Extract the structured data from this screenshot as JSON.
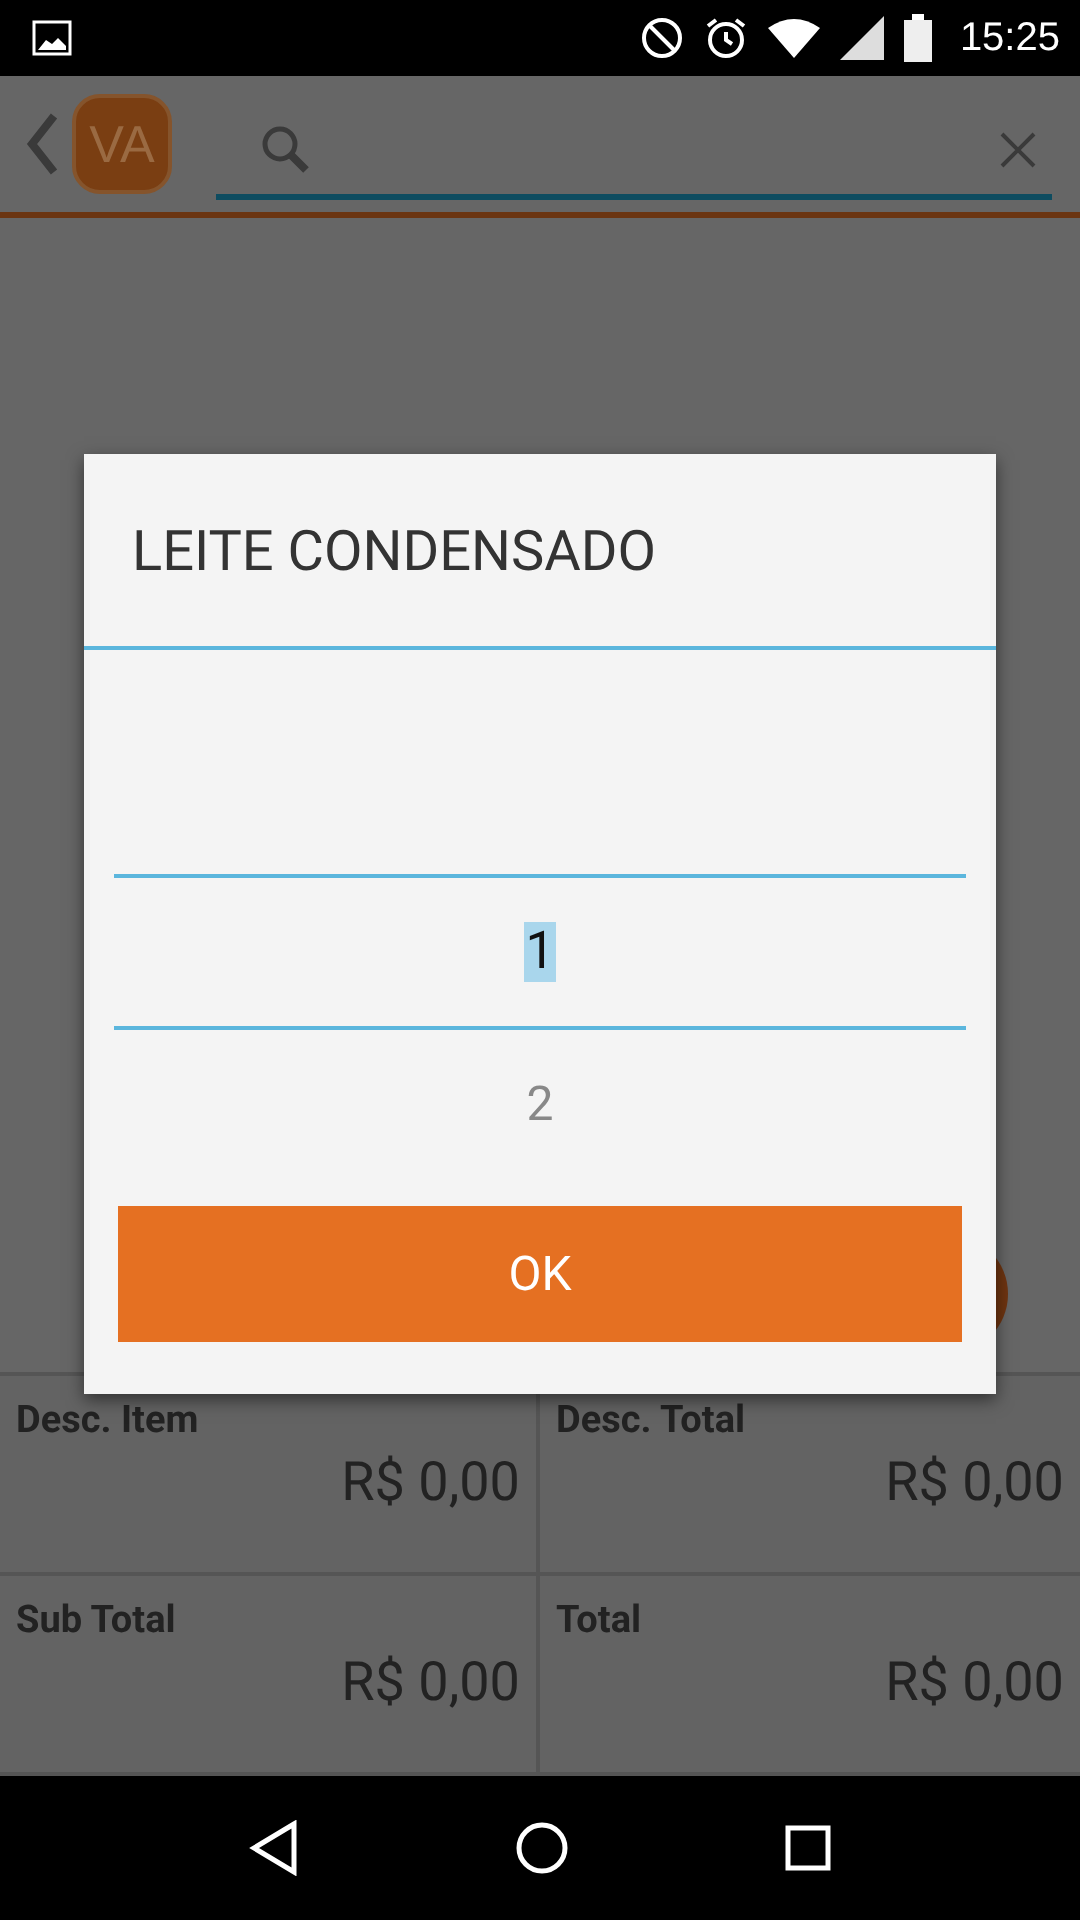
{
  "status_bar": {
    "time": "15:25"
  },
  "toolbar": {
    "avatar": "VA"
  },
  "dialog": {
    "title": "LEITE CONDENSADO",
    "picker": {
      "values": [
        {
          "label": "1",
          "selected": true
        },
        {
          "label": "2",
          "selected": false
        }
      ]
    },
    "button": "OK"
  },
  "summary": [
    {
      "label": "Desc. Item",
      "value": "R$ 0,00"
    },
    {
      "label": "Desc. Total",
      "value": "R$ 0,00"
    },
    {
      "label": "Sub Total",
      "value": "R$ 0,00"
    },
    {
      "label": "Total",
      "value": "R$ 0,00"
    }
  ]
}
